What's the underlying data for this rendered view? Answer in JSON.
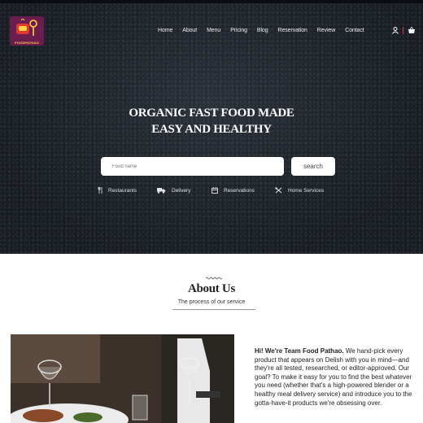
{
  "header": {
    "logo_text": "FOODPATHAO",
    "nav": [
      "Home",
      "About",
      "Menu",
      "Pricing",
      "Blog",
      "Reservation",
      "Review",
      "Contact"
    ],
    "icons": [
      "user-icon",
      "basket-icon"
    ]
  },
  "hero": {
    "title_line1": "ORGANIC FAST FOOD MADE",
    "title_line2": "EASY AND HEALTHY",
    "search_placeholder": "Food name",
    "search_button": "search",
    "services": [
      {
        "label": "Restaurants",
        "icon": "restaurant-icon"
      },
      {
        "label": "Delivery",
        "icon": "delivery-truck-icon"
      },
      {
        "label": "Reservations",
        "icon": "calendar-icon"
      },
      {
        "label": "Home Services",
        "icon": "tools-icon"
      }
    ]
  },
  "about": {
    "title": "About Us",
    "subtitle": "The process of our service",
    "intro_bold": "Hi! We're Team Food Pathao.",
    "intro_text": " We hand-pick every product that appears on Delish with you in mind—and they're all tested, researched, or editor-approved. Our goal? To make it easy for you to find the best whatever you need (whether that's a high-powered blender or a healthy meal delivery service) and introduce you to the gotta-have-it products we're obsessing over."
  },
  "colors": {
    "hero_bg": "#1c2129",
    "logo_bg": "#6b1d4e",
    "accent": "#d33333"
  }
}
